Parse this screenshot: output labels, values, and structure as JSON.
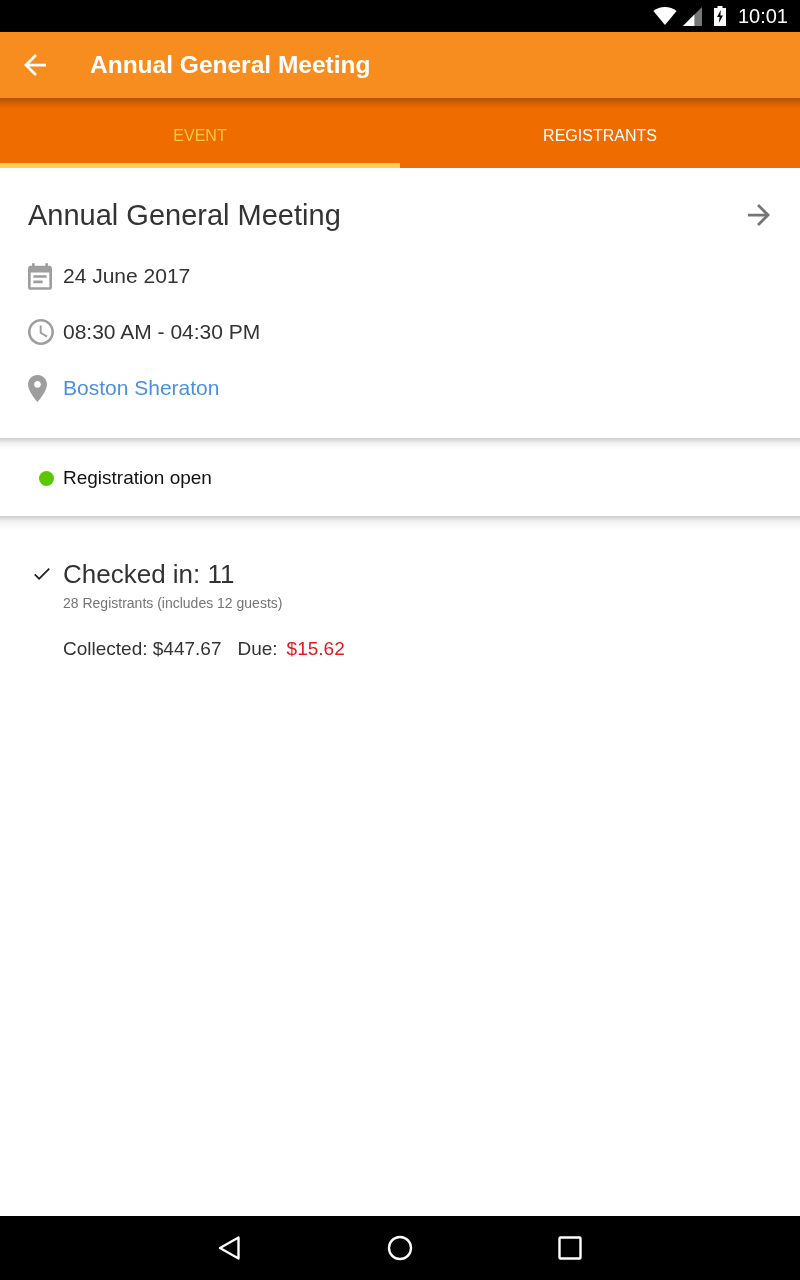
{
  "status_bar": {
    "time": "10:01"
  },
  "app_bar": {
    "title": "Annual General Meeting"
  },
  "tabs": [
    {
      "label": "EVENT",
      "selected": true
    },
    {
      "label": "REGISTRANTS",
      "selected": false
    }
  ],
  "event": {
    "title": "Annual General Meeting",
    "details": [
      {
        "kind": "date",
        "text": "24 June 2017"
      },
      {
        "kind": "time",
        "text": "08:30 AM - 04:30 PM"
      },
      {
        "kind": "location",
        "text": "Boston Sheraton"
      }
    ]
  },
  "registration_status": {
    "label": "Registration open",
    "color": "#5cc600"
  },
  "summary": {
    "checked_in": "Checked in: 11",
    "registrants": "28 Registrants (includes 12 guests)",
    "collected": "Collected: $447.67",
    "due_label": "Due:",
    "due_amount": "$15.62"
  }
}
